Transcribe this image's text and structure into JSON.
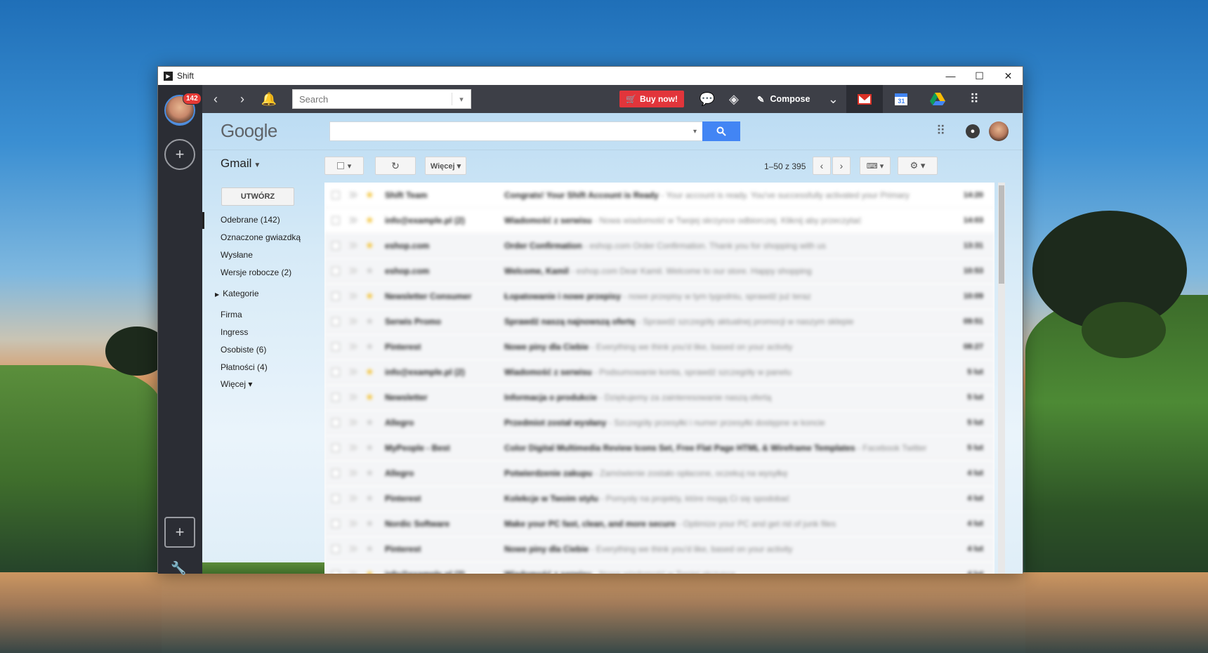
{
  "window": {
    "title": "Shift",
    "minimize": "—",
    "maximize": "☐",
    "close": "✕"
  },
  "rail": {
    "badge": "142",
    "add_icon": "+",
    "add_square_icon": "+",
    "wrench_icon": "🔧"
  },
  "toolbar": {
    "back": "‹",
    "forward": "›",
    "notifications": "🔔",
    "search_placeholder": "Search",
    "search_dropdown": "▾",
    "buy_now": "Buy now!",
    "compose": "Compose",
    "compose_dropdown": "⌄",
    "apps_grid": "⠿"
  },
  "gmail": {
    "logo_text": "Google",
    "search_dropdown": "▾",
    "search_button": "🔍",
    "label": "Gmail",
    "more_button": "Więcej ▾",
    "pager": "1–50 z 395",
    "compose_button": "UTWÓRZ"
  },
  "nav": [
    {
      "label": "Odebrane (142)",
      "bold": true
    },
    {
      "label": "Oznaczone gwiazdką",
      "bold": false
    },
    {
      "label": "Wysłane",
      "bold": false
    },
    {
      "label": "Wersje robocze (2)",
      "bold": true
    },
    {
      "label": "Kategorie",
      "bold": true
    },
    {
      "label": "Firma",
      "bold": false
    },
    {
      "label": "Ingress",
      "bold": false
    },
    {
      "label": "Osobiste (6)",
      "bold": true
    },
    {
      "label": "Płatności (4)",
      "bold": true
    },
    {
      "label": "Więcej ▾",
      "bold": false
    }
  ],
  "messages": [
    {
      "sender": "Shift Team",
      "subject": "Congrats! Your Shift Account is Ready",
      "snippet": "- Your account is ready. You've successfully activated your Primary",
      "date": "14:20",
      "starred": true,
      "unread": true
    },
    {
      "sender": "info@example.pl (2)",
      "subject": "Wiadomość z serwisu",
      "snippet": "- Nowa wiadomość w Twojej skrzynce odbiorczej. Kliknij aby przeczytać",
      "date": "14:03",
      "starred": true,
      "unread": true
    },
    {
      "sender": "eshop.com",
      "subject": "Order Confirmation",
      "snippet": "- eshop.com Order Confirmation. Thank you for shopping with us",
      "date": "13:31",
      "starred": true,
      "unread": false
    },
    {
      "sender": "eshop.com",
      "subject": "Welcome, Kamil",
      "snippet": "- eshop.com Dear Kamil. Welcome to our store. Happy shopping",
      "date": "10:53",
      "starred": false,
      "unread": false
    },
    {
      "sender": "Newsletter Consumer",
      "subject": "Łopatowanie i nowe przepisy",
      "snippet": "- nowe przepisy w tym tygodniu, sprawdź już teraz",
      "date": "10:09",
      "starred": true,
      "unread": false
    },
    {
      "sender": "Serwis Promo",
      "subject": "Sprawdź naszą najnowszą ofertę",
      "snippet": "- Sprawdź szczegóły aktualnej promocji w naszym sklepie",
      "date": "09:51",
      "starred": false,
      "unread": false
    },
    {
      "sender": "Pinterest",
      "subject": "Nowe piny dla Ciebie",
      "snippet": "- Everything we think you'd like, based on your activity",
      "date": "08:27",
      "starred": false,
      "unread": false
    },
    {
      "sender": "info@example.pl (2)",
      "subject": "Wiadomość z serwisu",
      "snippet": "- Podsumowanie konta, sprawdź szczegóły w panelu",
      "date": "5 lut",
      "starred": true,
      "unread": false
    },
    {
      "sender": "Newsletter",
      "subject": "Informacja o produkcie",
      "snippet": "- Dziękujemy za zainteresowanie naszą ofertą",
      "date": "5 lut",
      "starred": true,
      "unread": false
    },
    {
      "sender": "Allegro",
      "subject": "Przedmiot został wysłany",
      "snippet": "- Szczegóły przesyłki i numer przesyłki dostępne w koncie",
      "date": "5 lut",
      "starred": false,
      "unread": false
    },
    {
      "sender": "MyPeople - Best",
      "subject": "Color Digital Multimedia Review Icons Set, Free Flat Page HTML & Wireframe Templates",
      "snippet": "- Facebook Twitter",
      "date": "5 lut",
      "starred": false,
      "unread": false
    },
    {
      "sender": "Allegro",
      "subject": "Potwierdzenie zakupu",
      "snippet": "- Zamówienie zostało opłacone, oczekuj na wysyłkę",
      "date": "4 lut",
      "starred": false,
      "unread": false
    },
    {
      "sender": "Pinterest",
      "subject": "Kolekcje w Twoim stylu",
      "snippet": "- Pomysły na projekty, które mogą Ci się spodobać",
      "date": "4 lut",
      "starred": false,
      "unread": false
    },
    {
      "sender": "Nordic Software",
      "subject": "Make your PC fast, clean, and more secure",
      "snippet": "- Optimize your PC and get rid of junk files",
      "date": "4 lut",
      "starred": false,
      "unread": false
    },
    {
      "sender": "Pinterest",
      "subject": "Nowe piny dla Ciebie",
      "snippet": "- Everything we think you'd like, based on your activity",
      "date": "4 lut",
      "starred": false,
      "unread": false
    },
    {
      "sender": "info@example.pl (2)",
      "subject": "Wiadomość z serwisu",
      "snippet": "- Nowa wiadomość w Twojej skrzynce",
      "date": "4 lut",
      "starred": true,
      "unread": false
    }
  ]
}
